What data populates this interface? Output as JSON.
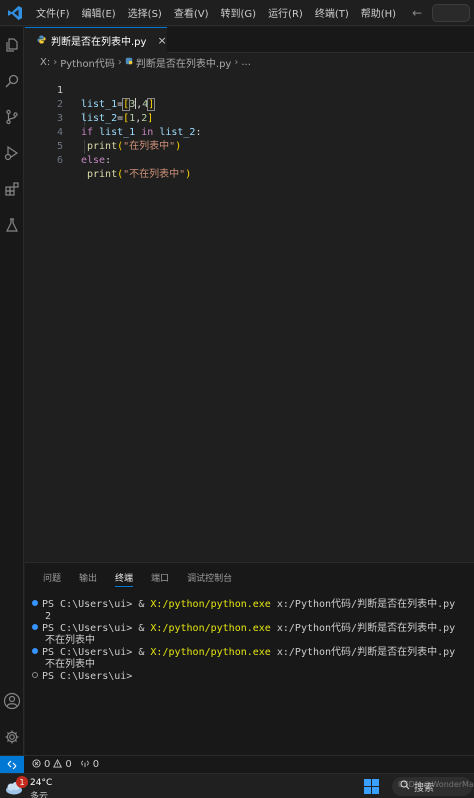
{
  "menu": [
    "文件(F)",
    "编辑(E)",
    "选择(S)",
    "查看(V)",
    "转到(G)",
    "运行(R)",
    "终端(T)",
    "帮助(H)"
  ],
  "tab": {
    "label": "判断是否在列表中.py",
    "close": "×"
  },
  "breadcrumb": {
    "drive": "X:",
    "folder": "Python代码",
    "file": "判断是否在列表中.py",
    "more": "..."
  },
  "editor": {
    "line_numbers": [
      "1",
      "2",
      "3",
      "4",
      "5",
      "6"
    ],
    "line1": {
      "var": "list_1",
      "eq": "=",
      "open": "[",
      "n1": "3",
      "comma": ",",
      "n2": "4",
      "close": "]"
    },
    "line2": {
      "var": "list_2",
      "eq": "=",
      "open": "[",
      "n1": "1",
      "comma": ",",
      "n2": "2",
      "close": "]"
    },
    "line3": {
      "kw_if": "if",
      "a": "list_1",
      "kw_in": "in",
      "b": "list_2",
      "colon": ":"
    },
    "line4": {
      "fn": "print",
      "open": "(",
      "str": "\"在列表中\"",
      "close": ")"
    },
    "line5": {
      "kw": "else",
      "colon": ":"
    },
    "line6": {
      "fn": "print",
      "open": "(",
      "str": "\"不在列表中\"",
      "close": ")"
    }
  },
  "panel": {
    "tabs": [
      "问题",
      "输出",
      "终端",
      "端口",
      "调试控制台"
    ],
    "active_tab": "终端",
    "terminal": {
      "prompt": "PS C:\\Users\\ui>",
      "amp": "&",
      "exe": "X:/python/python.exe",
      "script": "x:/Python代码/判断是否在列表中.py",
      "outputs": [
        "2",
        "不在列表中",
        "不在列表中"
      ]
    }
  },
  "statusbar": {
    "errors": "0",
    "warnings": "0",
    "ports": "0"
  },
  "taskbar": {
    "badge": "1",
    "temperature": "24°C",
    "condition": "多云",
    "search": "搜索",
    "watermark": "CSDN @WonderMan"
  },
  "colors": {
    "accent": "#0078d4",
    "background": "#1f1f1f",
    "terminal_yellow": "#e5e510"
  }
}
